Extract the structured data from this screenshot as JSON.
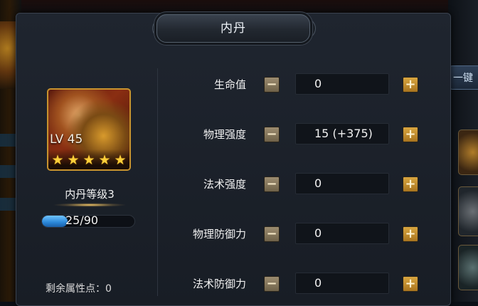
{
  "dialog": {
    "title": "内丹"
  },
  "hero": {
    "level": "LV 45",
    "star_count": 5,
    "star_glyph": "★",
    "dan_level": "内丹等级3",
    "exp_text": "25/90",
    "exp_fraction": 0.28
  },
  "remaining_points": "剩余属性点：0",
  "side_tab": {
    "label": "一键"
  },
  "attributes": [
    {
      "label": "生命值",
      "value": "0",
      "minus": "−",
      "plus": "+"
    },
    {
      "label": "物理强度",
      "value": "15 (+375)",
      "minus": "−",
      "plus": "+"
    },
    {
      "label": "法术强度",
      "value": "0",
      "minus": "−",
      "plus": "+"
    },
    {
      "label": "物理防御力",
      "value": "0",
      "minus": "−",
      "plus": "+"
    },
    {
      "label": "法术防御力",
      "value": "0",
      "minus": "−",
      "plus": "+"
    }
  ],
  "colors": {
    "panel": "#1f252f",
    "accent_gold": "#c8932e",
    "plus_button": "#d9a640",
    "exp_bar": "#2a86d8"
  }
}
